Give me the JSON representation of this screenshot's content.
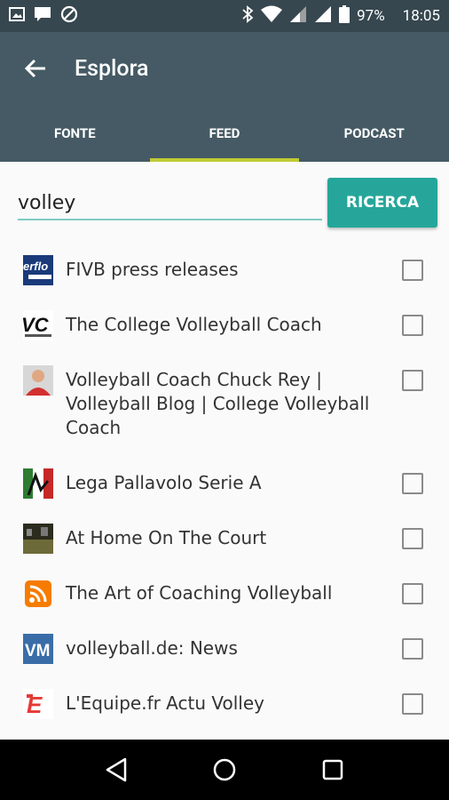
{
  "status_bar": {
    "battery": "97%",
    "time": "18:05"
  },
  "app_bar": {
    "title": "Esplora"
  },
  "tabs": [
    {
      "label": "FONTE",
      "active": false
    },
    {
      "label": "FEED",
      "active": true
    },
    {
      "label": "PODCAST",
      "active": false
    }
  ],
  "search": {
    "value": "volley",
    "button_label": "RICERCA"
  },
  "feeds": [
    {
      "label": "FIVB press releases",
      "icon": "fivb-logo",
      "checked": false
    },
    {
      "label": "The College Volleyball Coach",
      "icon": "cvc-logo",
      "checked": false
    },
    {
      "label": "Volleyball Coach Chuck Rey | Volleyball Blog | College Volleyball Coach",
      "icon": "coach-avatar",
      "checked": false
    },
    {
      "label": "Lega Pallavolo Serie A",
      "icon": "lega-logo",
      "checked": false
    },
    {
      "label": "At Home On The Court",
      "icon": "court-photo",
      "checked": false
    },
    {
      "label": "The Art of Coaching Volleyball",
      "icon": "rss-icon",
      "checked": false
    },
    {
      "label": "volleyball.de: News",
      "icon": "vm-logo",
      "checked": false
    },
    {
      "label": "L'Equipe.fr Actu Volley",
      "icon": "lequipe-logo",
      "checked": false
    }
  ],
  "colors": {
    "app_bar": "#455a64",
    "status_bar": "#37474f",
    "tab_indicator": "#c0ca33",
    "accent": "#26a69a",
    "input_underline": "#80cbc4"
  }
}
